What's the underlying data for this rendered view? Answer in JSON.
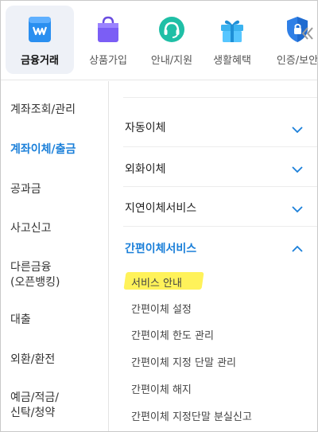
{
  "top_categories": [
    {
      "label": "금융거래",
      "icon": "finance-icon",
      "active": true
    },
    {
      "label": "상품가입",
      "icon": "shopping-bag-icon",
      "active": false
    },
    {
      "label": "안내/지원",
      "icon": "headset-icon",
      "active": false
    },
    {
      "label": "생활혜택",
      "icon": "gift-icon",
      "active": false
    },
    {
      "label": "인증/보안",
      "icon": "shield-icon",
      "active": false
    }
  ],
  "left_menu": [
    {
      "label": "계좌조회/관리",
      "active": false
    },
    {
      "label": "계좌이체/출금",
      "active": true
    },
    {
      "label": "공과금",
      "active": false
    },
    {
      "label": "사고신고",
      "active": false
    },
    {
      "label": "다른금융",
      "label2": "(오픈뱅킹)",
      "active": false
    },
    {
      "label": "대출",
      "active": false
    },
    {
      "label": "외환/환전",
      "active": false
    },
    {
      "label": "예금/적금/",
      "label2": "신탁/청약",
      "active": false
    }
  ],
  "sections": [
    {
      "label": "자동이체",
      "expanded": false
    },
    {
      "label": "외화이체",
      "expanded": false
    },
    {
      "label": "지연이체서비스",
      "expanded": false
    },
    {
      "label": "간편이체서비스",
      "expanded": true
    }
  ],
  "sub_items": [
    "서비스 안내",
    "간편이체 설정",
    "간편이체 한도 관리",
    "간편이체 지정 단말 관리",
    "간편이체 해지",
    "간편이체 지정단말 분실신고"
  ],
  "colors": {
    "accent": "#1a7fd9",
    "highlight": "#fff25a",
    "active_tab_bg": "#eef1f7"
  }
}
